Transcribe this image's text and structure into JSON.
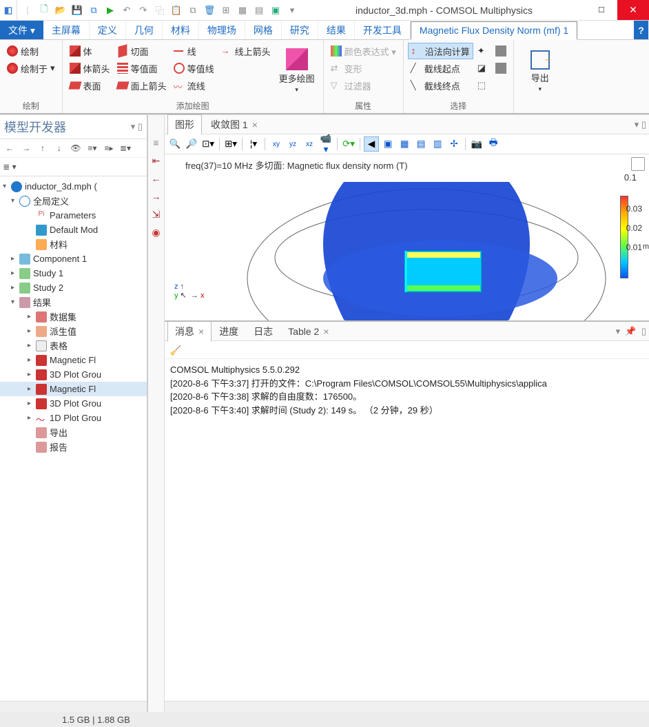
{
  "title": "inductor_3d.mph - COMSOL Multiphysics",
  "menu": {
    "file": "文件 ▾",
    "tabs": [
      "主屏幕",
      "定义",
      "几何",
      "材料",
      "物理场",
      "网格",
      "研究",
      "结果",
      "开发工具",
      "Magnetic Flux Density Norm (mf) 1"
    ]
  },
  "ribbon": {
    "draw": {
      "label": "绘制",
      "plot": "绘制",
      "plot_in": "绘制于"
    },
    "add": {
      "label": "添加绘图",
      "items": {
        "vol": "体",
        "slice": "切面",
        "line": "线",
        "arrow_line": "线上箭头",
        "arrow_vol": "体箭头",
        "iso": "等值面",
        "contour": "等值线",
        "surf": "表面",
        "arrow_surf": "面上箭头",
        "stream": "流线",
        "more": "更多绘图"
      }
    },
    "attr": {
      "label": "属性",
      "color_expr": "颜色表达式 ▾",
      "deform": "变形",
      "filter": "过滤器"
    },
    "select": {
      "label": "选择",
      "along_normal": "沿法向计算",
      "cut_start": "截线起点",
      "cut_end": "截线终点"
    },
    "export": {
      "label": "导出"
    }
  },
  "left": {
    "title": "模型开发器",
    "tree": {
      "root": "inductor_3d.mph (",
      "global_def": "全局定义",
      "parameters": "Parameters",
      "default_model": "Default Mod",
      "materials": "材料",
      "component1": "Component 1",
      "study1": "Study 1",
      "study2": "Study 2",
      "results": "结果",
      "datasets": "数据集",
      "derived": "派生值",
      "tables": "表格",
      "mag_flux": "Magnetic Fl",
      "plot3d_1": "3D Plot Grou",
      "mag_flux2": "Magnetic Fl",
      "plot3d_2": "3D Plot Grou",
      "plot1d": "1D Plot Grou",
      "export_n": "导出",
      "report": "报告"
    }
  },
  "gfx": {
    "tab_graphics": "图形",
    "tab_conv": "收敛图 1",
    "plot_label": "freq(37)=10 MHz    多切面: Magnetic flux density norm (T)",
    "axes": {
      "x": "x",
      "y": "y",
      "z": "z"
    },
    "legend_top": "0.1",
    "ticks": [
      "0.03",
      "0.02",
      "0.01"
    ],
    "unit": "m"
  },
  "messages": {
    "tabs": {
      "msg": "消息",
      "progress": "进度",
      "log": "日志",
      "table": "Table 2"
    },
    "lines": [
      "COMSOL Multiphysics 5.5.0.292",
      "[2020-8-6 下午3:37] 打开的文件：C:\\Program Files\\COMSOL\\COMSOL55\\Multiphysics\\applica",
      "[2020-8-6 下午3:38] 求解的自由度数：176500。",
      "[2020-8-6 下午3:40] 求解时间 (Study 2): 149 s。   （2 分钟，29 秒）"
    ]
  },
  "status": "1.5 GB | 1.88 GB"
}
